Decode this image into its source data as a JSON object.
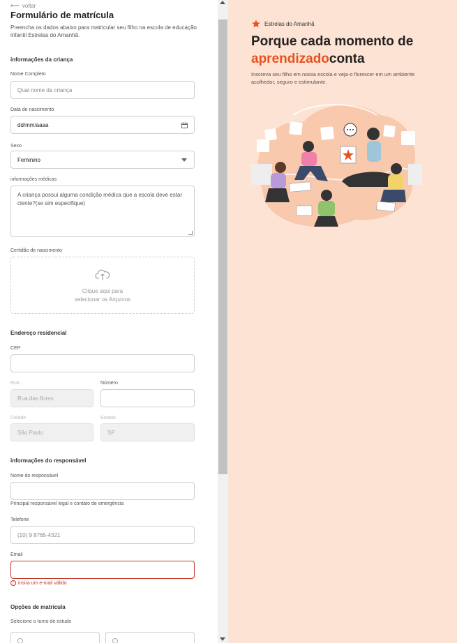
{
  "form": {
    "back_label": "voltar",
    "title": "Formulário de matrícula",
    "intro": "Preencha os dados abaixo para matricular seu filho na escola de educação infantil Estrelas do Amanhã.",
    "child_section": "informações da criança",
    "full_name": {
      "label": "Nome Completo",
      "placeholder": "Qual nome da criança"
    },
    "birth_date": {
      "label": "Data de nascimento",
      "value": "dd/mm/aaaa"
    },
    "sex": {
      "label": "Sexo",
      "value": "Feminino"
    },
    "medical": {
      "label": "informações médicas",
      "placeholder": "A criança possui alguma condição médica que a escola deve estar ciente?(se sim especifique)"
    },
    "birth_certificate": {
      "label": "Certidão de nascimento",
      "line1": "Clique aqui para",
      "line2": "selecionar os Arquivos"
    },
    "address_section": "Endereço residencial",
    "cep": {
      "label": "CEP",
      "value": ""
    },
    "street": {
      "label": "Rua",
      "value": "Rua das flores"
    },
    "number": {
      "label": "Número",
      "value": ""
    },
    "city": {
      "label": "Cidade",
      "value": "São Paulo"
    },
    "state": {
      "label": "Estado",
      "value": "SP"
    },
    "guardian_section": "informações do responsável",
    "guardian_name": {
      "label": "Nome do responsável",
      "value": "",
      "hint": "Principal responsável legal e contato de emergência"
    },
    "phone": {
      "label": "Telefone",
      "placeholder": "(10) 9 8765-4321"
    },
    "email": {
      "label": "Email",
      "value": "",
      "error": "insira um e-mail válido"
    },
    "enrollment_section": "Opções de matrícula",
    "shift": {
      "label": "Selecione o turno de estudo"
    }
  },
  "hero": {
    "brand": "Estrelas do Amanhã",
    "title_part1": "Porque cada momento de ",
    "title_accent": "aprendizado",
    "title_part2": "conta",
    "description": "Inscreva seu filho em nossa escola e veja-o florescer em um ambiente acolhedor, seguro e estimulante."
  },
  "colors": {
    "accent": "#e8501e",
    "hero_bg": "#fde3d3",
    "error": "#c0392b"
  }
}
